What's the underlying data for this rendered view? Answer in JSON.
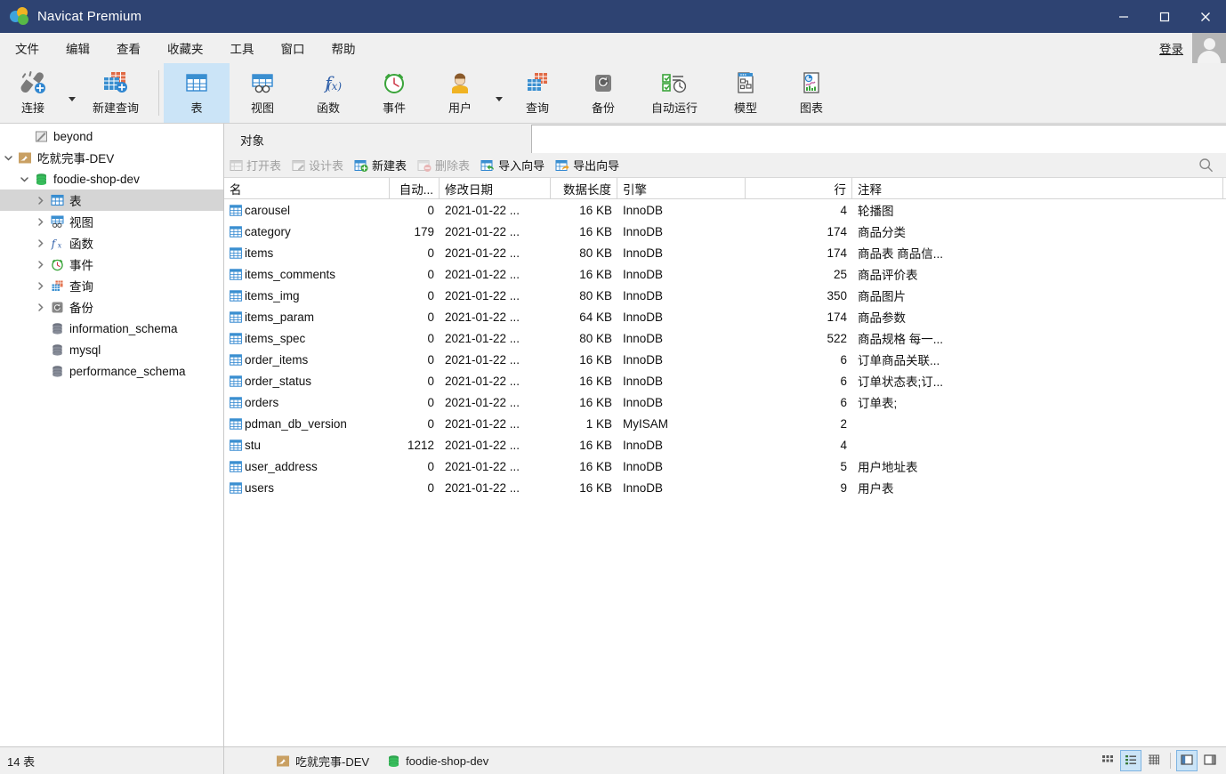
{
  "window": {
    "title": "Navicat Premium",
    "logo_icon": "navicat-logo-icon",
    "minimize_label": "–",
    "maximize_label": "□",
    "close_label": "✕"
  },
  "menubar": {
    "items": [
      {
        "label": "文件",
        "name": "menu-file"
      },
      {
        "label": "编辑",
        "name": "menu-edit"
      },
      {
        "label": "查看",
        "name": "menu-view"
      },
      {
        "label": "收藏夹",
        "name": "menu-favorites"
      },
      {
        "label": "工具",
        "name": "menu-tools"
      },
      {
        "label": "窗口",
        "name": "menu-window"
      },
      {
        "label": "帮助",
        "name": "menu-help"
      }
    ],
    "login_label": "登录",
    "avatar_icon": "user-avatar-icon"
  },
  "ribbon": {
    "items": [
      {
        "label": "连接",
        "icon": "connection-icon",
        "active": false,
        "caret": true
      },
      {
        "label": "新建查询",
        "icon": "new-query-icon",
        "active": false,
        "caret": false
      },
      {
        "label": "表",
        "icon": "table-icon",
        "active": true,
        "caret": false
      },
      {
        "label": "视图",
        "icon": "view-icon",
        "active": false,
        "caret": false
      },
      {
        "label": "函数",
        "icon": "function-fx-icon",
        "active": false,
        "caret": false
      },
      {
        "label": "事件",
        "icon": "event-clock-icon",
        "active": false,
        "caret": false
      },
      {
        "label": "用户",
        "icon": "user-icon",
        "active": false,
        "caret": true
      },
      {
        "label": "查询",
        "icon": "query-icon",
        "active": false,
        "caret": false
      },
      {
        "label": "备份",
        "icon": "backup-icon",
        "active": false,
        "caret": false
      },
      {
        "label": "自动运行",
        "icon": "automation-icon",
        "active": false,
        "caret": false
      },
      {
        "label": "模型",
        "icon": "model-icon",
        "active": false,
        "caret": false
      },
      {
        "label": "图表",
        "icon": "chart-icon",
        "active": false,
        "caret": false
      }
    ]
  },
  "sidebar": {
    "items": [
      {
        "label": "beyond",
        "icon": "connection-gray-icon",
        "indent": 1,
        "arrow": "none",
        "selected": false
      },
      {
        "label": "吃就完事-DEV",
        "icon": "mysql-connection-icon",
        "indent": 0,
        "arrow": "expanded",
        "selected": false
      },
      {
        "label": "foodie-shop-dev",
        "icon": "database-open-icon",
        "indent": 1,
        "arrow": "expanded",
        "selected": false
      },
      {
        "label": "表",
        "icon": "table-folder-icon",
        "indent": 2,
        "arrow": "collapsed",
        "selected": true
      },
      {
        "label": "视图",
        "icon": "view-folder-icon",
        "indent": 2,
        "arrow": "collapsed",
        "selected": false
      },
      {
        "label": "函数",
        "icon": "function-folder-icon",
        "indent": 2,
        "arrow": "collapsed",
        "selected": false
      },
      {
        "label": "事件",
        "icon": "event-folder-icon",
        "indent": 2,
        "arrow": "collapsed",
        "selected": false
      },
      {
        "label": "查询",
        "icon": "query-folder-icon",
        "indent": 2,
        "arrow": "collapsed",
        "selected": false
      },
      {
        "label": "备份",
        "icon": "backup-folder-icon",
        "indent": 2,
        "arrow": "collapsed",
        "selected": false
      },
      {
        "label": "information_schema",
        "icon": "database-icon",
        "indent": 2,
        "arrow": "none",
        "selected": false
      },
      {
        "label": "mysql",
        "icon": "database-icon",
        "indent": 2,
        "arrow": "none",
        "selected": false
      },
      {
        "label": "performance_schema",
        "icon": "database-icon",
        "indent": 2,
        "arrow": "none",
        "selected": false
      }
    ]
  },
  "tabstrip": {
    "tab_label": "对象"
  },
  "object_toolbar": {
    "buttons": [
      {
        "label": "打开表",
        "icon": "open-table-icon",
        "enabled": false
      },
      {
        "label": "设计表",
        "icon": "design-table-icon",
        "enabled": false
      },
      {
        "label": "新建表",
        "icon": "new-table-icon",
        "enabled": true
      },
      {
        "label": "删除表",
        "icon": "delete-table-icon",
        "enabled": false
      },
      {
        "label": "导入向导",
        "icon": "import-wizard-icon",
        "enabled": true
      },
      {
        "label": "导出向导",
        "icon": "export-wizard-icon",
        "enabled": true
      }
    ],
    "search_icon": "search-icon"
  },
  "grid": {
    "columns": [
      {
        "key": "name",
        "label": "名",
        "align": "left"
      },
      {
        "key": "auto_increment",
        "label": "自动...",
        "align": "right"
      },
      {
        "key": "modified",
        "label": "修改日期",
        "align": "left"
      },
      {
        "key": "data_length",
        "label": "数据长度",
        "align": "right"
      },
      {
        "key": "engine",
        "label": "引擎",
        "align": "left"
      },
      {
        "key": "rows",
        "label": "行",
        "align": "right"
      },
      {
        "key": "comment",
        "label": "注释",
        "align": "left"
      }
    ],
    "rows": [
      {
        "name": "carousel",
        "auto_increment": "0",
        "modified": "2021-01-22 ...",
        "data_length": "16 KB",
        "engine": "InnoDB",
        "rows": "4",
        "comment": "轮播图"
      },
      {
        "name": "category",
        "auto_increment": "179",
        "modified": "2021-01-22 ...",
        "data_length": "16 KB",
        "engine": "InnoDB",
        "rows": "174",
        "comment": "商品分类"
      },
      {
        "name": "items",
        "auto_increment": "0",
        "modified": "2021-01-22 ...",
        "data_length": "80 KB",
        "engine": "InnoDB",
        "rows": "174",
        "comment": "商品表 商品信..."
      },
      {
        "name": "items_comments",
        "auto_increment": "0",
        "modified": "2021-01-22 ...",
        "data_length": "16 KB",
        "engine": "InnoDB",
        "rows": "25",
        "comment": "商品评价表"
      },
      {
        "name": "items_img",
        "auto_increment": "0",
        "modified": "2021-01-22 ...",
        "data_length": "80 KB",
        "engine": "InnoDB",
        "rows": "350",
        "comment": "商品图片"
      },
      {
        "name": "items_param",
        "auto_increment": "0",
        "modified": "2021-01-22 ...",
        "data_length": "64 KB",
        "engine": "InnoDB",
        "rows": "174",
        "comment": "商品参数"
      },
      {
        "name": "items_spec",
        "auto_increment": "0",
        "modified": "2021-01-22 ...",
        "data_length": "80 KB",
        "engine": "InnoDB",
        "rows": "522",
        "comment": "商品规格 每一..."
      },
      {
        "name": "order_items",
        "auto_increment": "0",
        "modified": "2021-01-22 ...",
        "data_length": "16 KB",
        "engine": "InnoDB",
        "rows": "6",
        "comment": "订单商品关联..."
      },
      {
        "name": "order_status",
        "auto_increment": "0",
        "modified": "2021-01-22 ...",
        "data_length": "16 KB",
        "engine": "InnoDB",
        "rows": "6",
        "comment": "订单状态表;订..."
      },
      {
        "name": "orders",
        "auto_increment": "0",
        "modified": "2021-01-22 ...",
        "data_length": "16 KB",
        "engine": "InnoDB",
        "rows": "6",
        "comment": "订单表;"
      },
      {
        "name": "pdman_db_version",
        "auto_increment": "0",
        "modified": "2021-01-22 ...",
        "data_length": "1 KB",
        "engine": "MyISAM",
        "rows": "2",
        "comment": ""
      },
      {
        "name": "stu",
        "auto_increment": "1212",
        "modified": "2021-01-22 ...",
        "data_length": "16 KB",
        "engine": "InnoDB",
        "rows": "4",
        "comment": ""
      },
      {
        "name": "user_address",
        "auto_increment": "0",
        "modified": "2021-01-22 ...",
        "data_length": "16 KB",
        "engine": "InnoDB",
        "rows": "5",
        "comment": "用户地址表"
      },
      {
        "name": "users",
        "auto_increment": "0",
        "modified": "2021-01-22 ...",
        "data_length": "16 KB",
        "engine": "InnoDB",
        "rows": "9",
        "comment": "用户表"
      }
    ]
  },
  "statusbar": {
    "count_label": "14 表",
    "connection_label": "吃就完事-DEV",
    "connection_icon": "mysql-connection-icon",
    "database_label": "foodie-shop-dev",
    "database_icon": "database-open-icon",
    "view_buttons": [
      {
        "name": "icon-view-button",
        "icon": "grid-dots-icon",
        "active": false
      },
      {
        "name": "list-view-button",
        "icon": "list-icon",
        "active": true
      },
      {
        "name": "detail-view-button",
        "icon": "table-grid-icon",
        "active": false
      },
      {
        "name": "left-pane-toggle-button",
        "icon": "pane-left-icon",
        "active": true
      },
      {
        "name": "right-pane-toggle-button",
        "icon": "pane-right-icon",
        "active": false
      }
    ]
  },
  "colors": {
    "titlebar": "#2e4372",
    "chrome": "#f0f0f0",
    "accent_selected": "#cbe4f7",
    "tree_selected": "#d5d5d5"
  }
}
